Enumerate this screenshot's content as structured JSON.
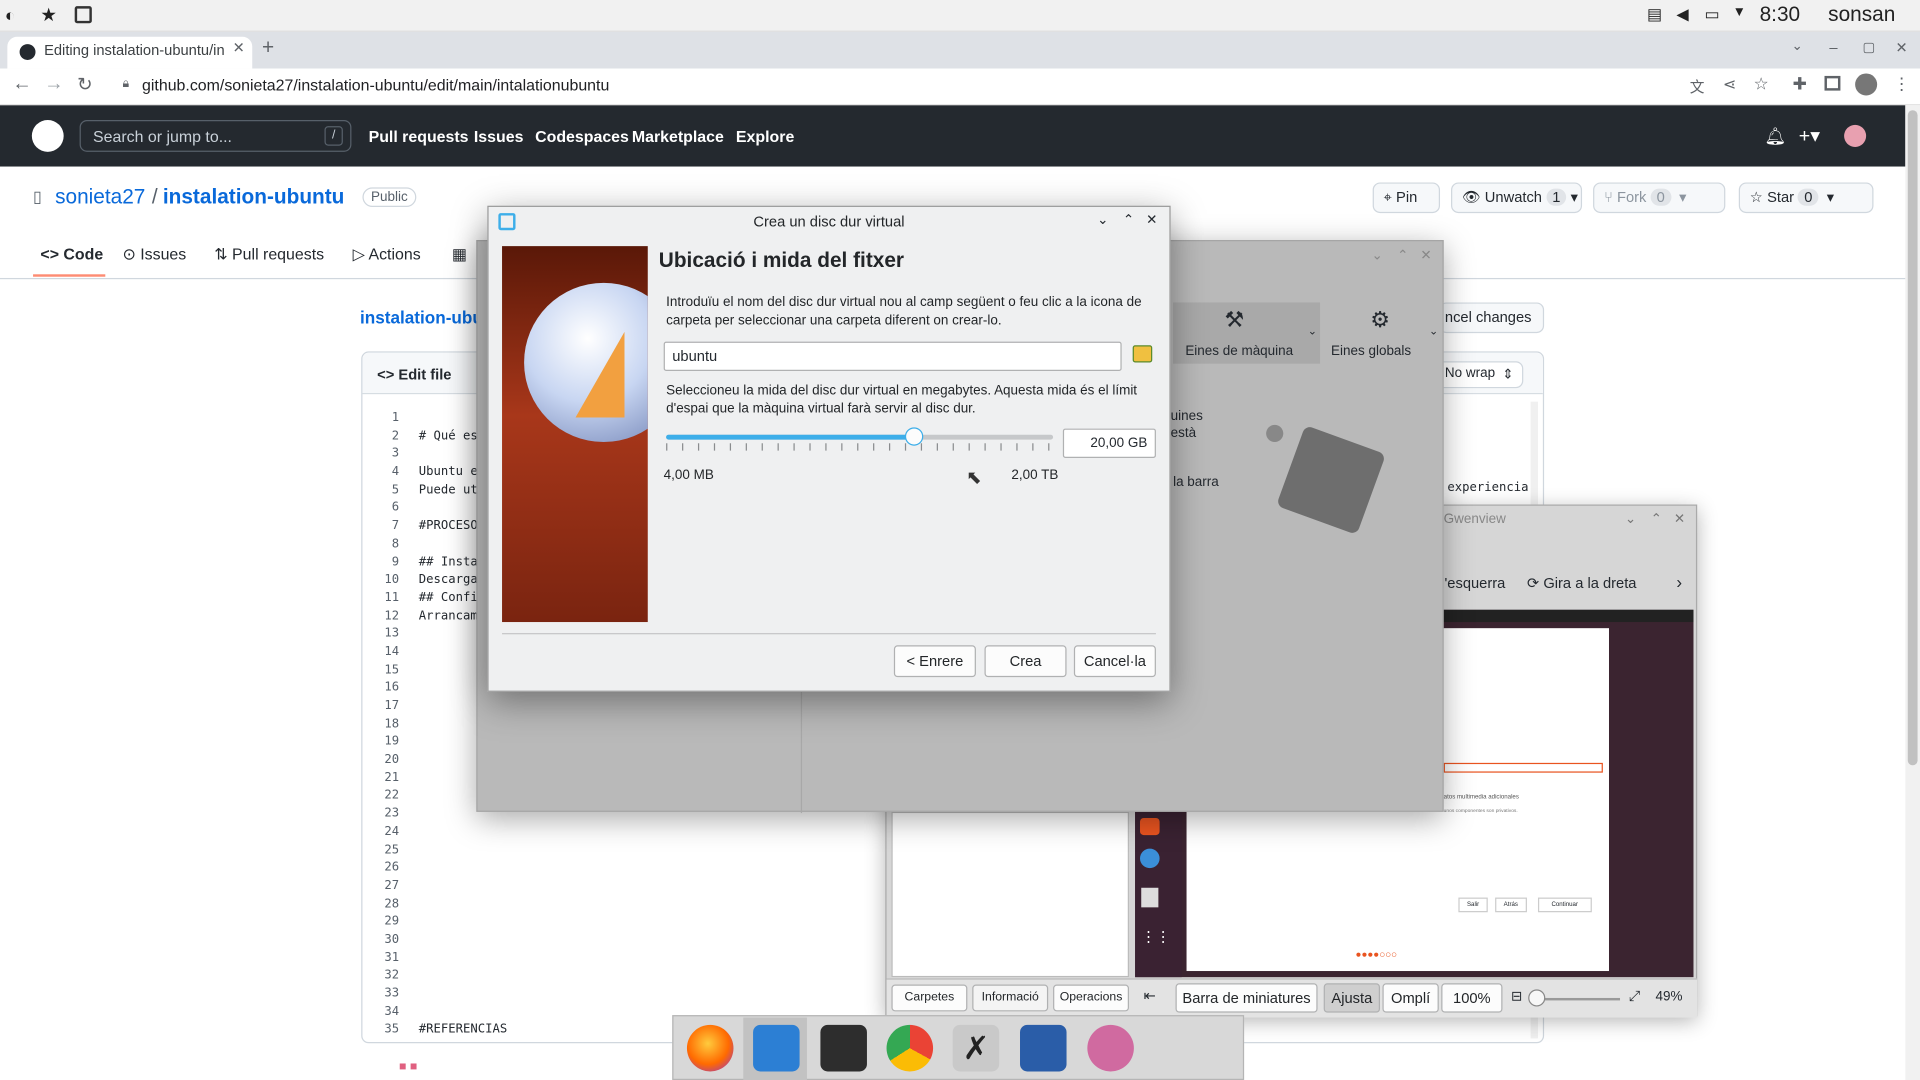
{
  "panel": {
    "time": "8:30",
    "user": "sonsan"
  },
  "browser": {
    "tab_title": "Editing instalation-ubuntu/in",
    "url": "github.com/sonieta27/instalation-ubuntu/edit/main/intalationubuntu",
    "new_tab": "+"
  },
  "github": {
    "search_placeholder": "Search or jump to...",
    "search_key": "/",
    "nav": [
      "Pull requests",
      "Issues",
      "Codespaces",
      "Marketplace",
      "Explore"
    ],
    "owner": "sonieta27",
    "sep": "/",
    "repo": "instalation-ubuntu",
    "visibility": "Public",
    "pin": "Pin",
    "unwatch": "Unwatch",
    "unwatch_count": "1",
    "fork": "Fork",
    "fork_count": "0",
    "star": "Star",
    "star_count": "0",
    "tabs": [
      "Code",
      "Issues",
      "Pull requests",
      "Actions"
    ],
    "breadcrumb": "instalation-ubu",
    "edit_file": "Edit file",
    "cancel_changes": "ncel changes",
    "wrap": "No wrap",
    "line_numbers": [
      "1",
      "2",
      "3",
      "4",
      "5",
      "6",
      "7",
      "8",
      "9",
      "10",
      "11",
      "12",
      "13",
      "14",
      "15",
      "16",
      "17",
      "18",
      "19",
      "20",
      "21",
      "22",
      "23",
      "24",
      "25",
      "26",
      "27",
      "28",
      "29",
      "30",
      "31",
      "32",
      "33",
      "34",
      "35"
    ],
    "code_lines": [
      "",
      "# Qué es",
      "",
      "Ubuntu e",
      "Puede ut",
      "",
      "#PROCESO",
      "",
      "## Insta",
      "Descarga",
      "## Confi",
      "Arrancam",
      "",
      "",
      "",
      "",
      "",
      "",
      "",
      "",
      "",
      "",
      "",
      "",
      "",
      "",
      "",
      "",
      "",
      "",
      "",
      "",
      "",
      "",
      "#REFERENCIAS"
    ]
  },
  "vbox_bg": {
    "machine_tools": "Eines de màquina",
    "global_tools": "Eines globals",
    "frag1": "uines",
    "frag2": "està",
    "frag3": "la barra",
    "frag4": "experiencia"
  },
  "gwenview": {
    "title": "Gwenview",
    "rotate_left": "l'esquerra",
    "rotate_right": "Gira a la dreta",
    "tabs": [
      "Carpetes",
      "Informació",
      "Operacions"
    ],
    "thumbbar": "Barra de miniatures",
    "fit": "Ajusta",
    "fill": "Omplí",
    "zoom100": "100%",
    "zoom": "49%",
    "inner": {
      "line1": "atos multimedia adicionales",
      "line2": "unos componentes son privativos.",
      "b1": "Salir",
      "b2": "Atrás",
      "b3": "Continuar"
    }
  },
  "dialog": {
    "title": "Crea un disc dur virtual",
    "heading": "Ubicació i mida del fitxer",
    "desc1": "Introduïu el nom del disc dur virtual nou al camp següent o feu clic a la icona de carpeta per seleccionar una carpeta diferent on crear-lo.",
    "filename": "ubuntu",
    "desc2": "Seleccioneu la mida del disc dur virtual en megabytes. Aquesta mida és el límit d'espai que la màquina virtual farà servir al disc dur.",
    "size": "20,00 GB",
    "size_fraction": 0.64,
    "min": "4,00 MB",
    "max": "2,00 TB",
    "back": "< Enrere",
    "create": "Crea",
    "cancel": "Cancel·la"
  },
  "colors": {
    "gh_dark": "#24292f",
    "accent": "#3daee9",
    "tab_underline": "#fd8c73"
  }
}
